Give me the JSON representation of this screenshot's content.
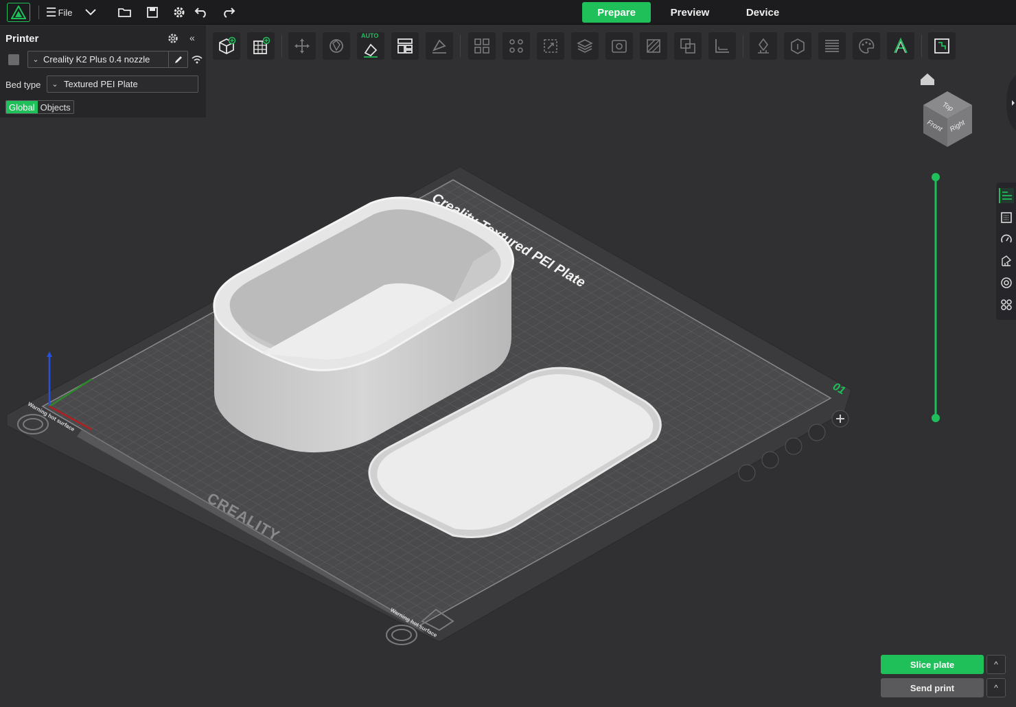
{
  "menu": {
    "file_label": "File"
  },
  "tabs": [
    {
      "label": "Prepare",
      "active": true
    },
    {
      "label": "Preview",
      "active": false
    },
    {
      "label": "Device",
      "active": false
    }
  ],
  "printer_panel": {
    "title": "Printer",
    "printer_name": "Creality K2 Plus 0.4 nozzle",
    "bed_type_label": "Bed type",
    "bed_type_value": "Textured PEI Plate",
    "mode_global": "Global",
    "mode_objects": "Objects"
  },
  "toolbar": {
    "auto_orient_badge": "AUTO",
    "tools": [
      "add-object",
      "add-plate",
      "move",
      "rotate",
      "auto-orient",
      "arrange",
      "lay-on-face",
      "split-objects",
      "split-parts",
      "scale",
      "variable-layer",
      "hollow",
      "cut",
      "boolean",
      "measure",
      "support-paint",
      "seam-paint",
      "layers",
      "color-paint",
      "text",
      "assembly"
    ]
  },
  "view_cube": {
    "top": "Top",
    "front": "Front",
    "right": "Right"
  },
  "plate": {
    "brand_text": "Creality Textured PEI Plate",
    "logo_text": "CREALITY",
    "plate_number": "01",
    "warning_text": "Warning hot surface"
  },
  "actions": {
    "slice_label": "Slice plate",
    "send_label": "Send print",
    "expand_glyph": "^"
  },
  "colors": {
    "accent": "#1fbf5a",
    "background": "#303032",
    "panel": "#262628"
  }
}
